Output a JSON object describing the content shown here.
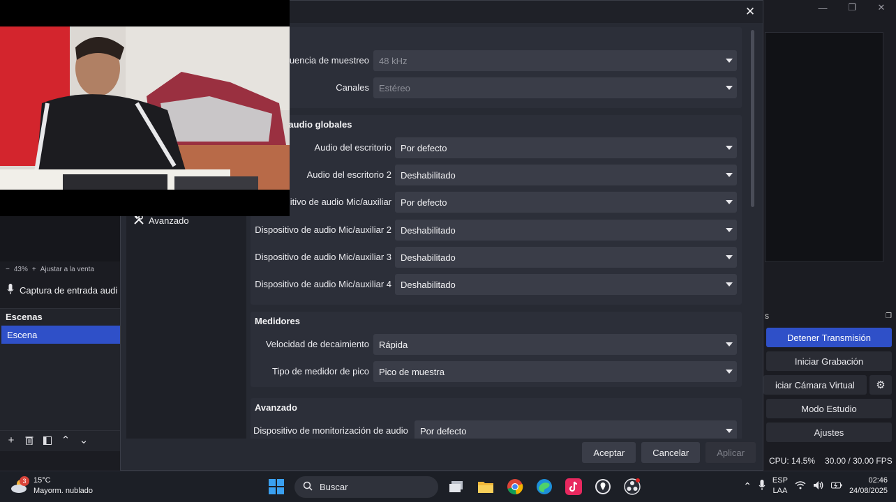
{
  "obs": {
    "zoom_level": "43%",
    "zoom_fit_label": "Ajustar a la venta",
    "audio_capture_source": "Captura de entrada audi",
    "scenes_header": "Escenas",
    "scene_selected": "Escena",
    "controls": {
      "header_partial": "s",
      "stop_stream": "Detener Transmisión",
      "start_recording": "Iniciar Grabación",
      "start_vcam_partial": "iciar Cámara Virtual",
      "studio_mode": "Modo Estudio",
      "settings": "Ajustes"
    },
    "status": {
      "cpu": "CPU: 14.5%",
      "fps": "30.00 / 30.00 FPS"
    }
  },
  "dialog": {
    "sidebar_visible_item": "Avanzado",
    "sample_rate": {
      "label": "cuencia de muestreo",
      "value": "48 kHz"
    },
    "channels": {
      "label": "Canales",
      "value": "Estéreo"
    },
    "global_audio_title": "ivos de audio globales",
    "global_audio": [
      {
        "label": "Audio del escritorio",
        "value": "Por defecto"
      },
      {
        "label": "Audio del escritorio 2",
        "value": "Deshabilitado"
      },
      {
        "label": "itivo de audio Mic/auxiliar",
        "value": "Por defecto"
      },
      {
        "label": "Dispositivo de audio Mic/auxiliar 2",
        "value": "Deshabilitado"
      },
      {
        "label": "Dispositivo de audio Mic/auxiliar 3",
        "value": "Deshabilitado"
      },
      {
        "label": "Dispositivo de audio Mic/auxiliar 4",
        "value": "Deshabilitado"
      }
    ],
    "meters_title": "Medidores",
    "meters": [
      {
        "label": "Velocidad de decaimiento",
        "value": "Rápida"
      },
      {
        "label": "Tipo de medidor de pico",
        "value": "Pico de muestra"
      }
    ],
    "advanced_title": "Avanzado",
    "monitoring": {
      "label": "Dispositivo de monitorización de audio",
      "value": "Por defecto"
    },
    "buttons": {
      "accept": "Aceptar",
      "cancel": "Cancelar",
      "apply": "Aplicar"
    }
  },
  "taskbar": {
    "weather_badge": "3",
    "temperature": "15°C",
    "weather_desc": "Mayorm. nublado",
    "search_placeholder": "Buscar",
    "lang_top": "ESP",
    "lang_bottom": "LAA",
    "time": "02:46",
    "date": "24/08/2025",
    "apps": [
      "windows-start-icon",
      "file-manager-icon",
      "folder-icon",
      "chrome-icon",
      "edge-icon",
      "tiktok-icon",
      "maps-icon",
      "obs-icon"
    ]
  },
  "colors": {
    "accent": "#2f50c8",
    "dialog_bg": "#272a33",
    "group_bg": "#2c2f39",
    "combo_bg": "#3a3d48"
  }
}
